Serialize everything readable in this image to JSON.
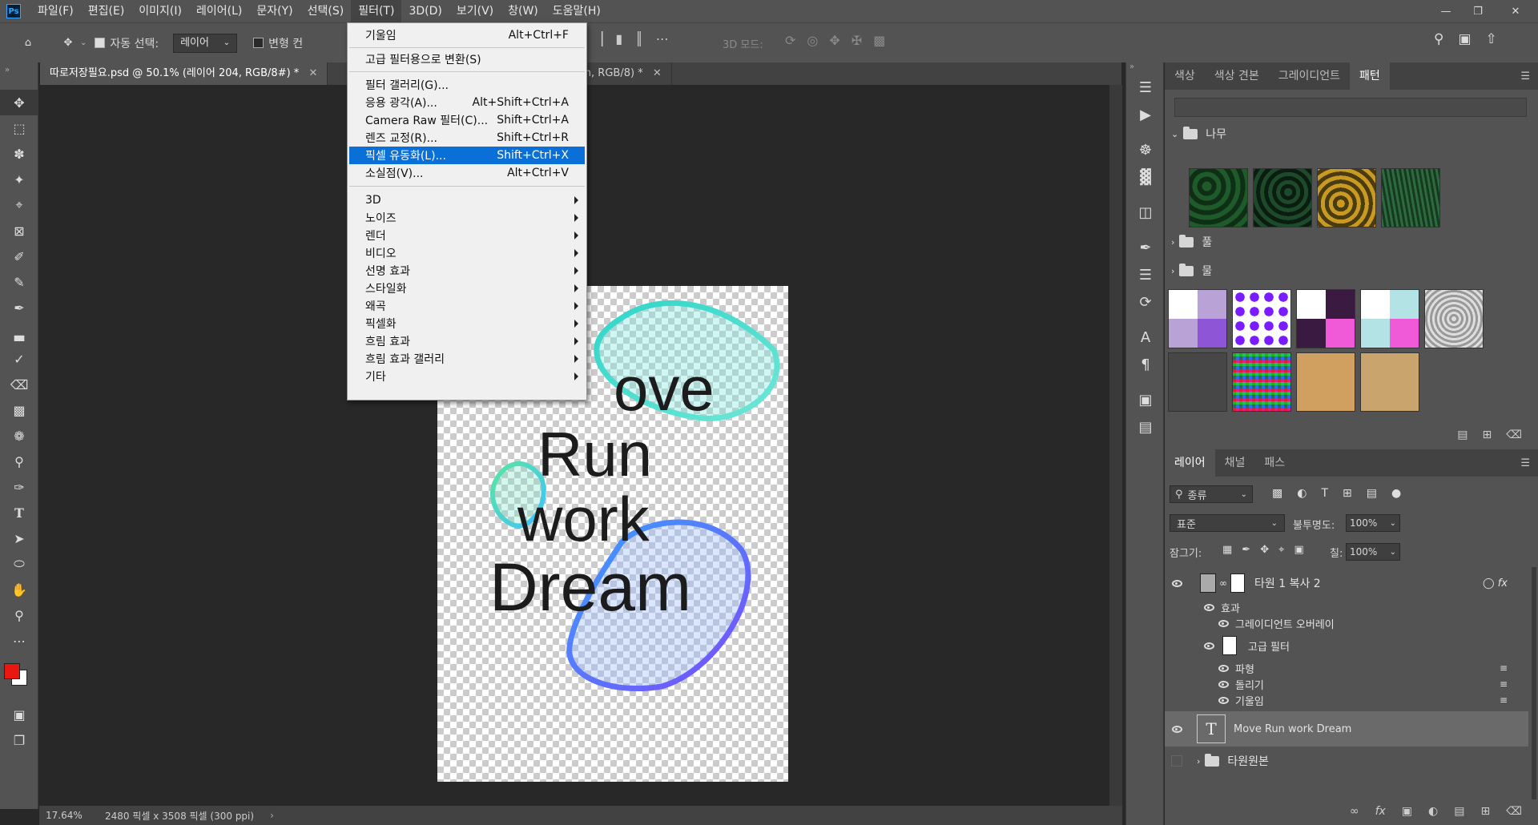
{
  "app": {
    "logo": "Ps"
  },
  "menubar": {
    "items": [
      "파일(F)",
      "편집(E)",
      "이미지(I)",
      "레이어(L)",
      "문자(Y)",
      "선택(S)",
      "필터(T)",
      "3D(D)",
      "보기(V)",
      "창(W)",
      "도움말(H)"
    ],
    "active_index": 6
  },
  "options": {
    "auto_select_label": "자동 선택:",
    "auto_select_value": "레이어",
    "transform_label": "변형 컨",
    "mode_3d_label": "3D 모드:"
  },
  "tabs": [
    {
      "label": "따로저장필요.psd @ 50.1% (레이어 204, RGB/8#) *"
    },
    {
      "label": "m, RGB/8) *"
    }
  ],
  "filter_menu": {
    "items": [
      {
        "label": "기울임",
        "shortcut": "Alt+Ctrl+F"
      },
      {
        "label": "고급 필터용으로 변환(S)",
        "shortcut": ""
      },
      {
        "label": "필터 갤러리(G)...",
        "shortcut": ""
      },
      {
        "label": "응용 광각(A)...",
        "shortcut": "Alt+Shift+Ctrl+A"
      },
      {
        "label": "Camera Raw 필터(C)...",
        "shortcut": "Shift+Ctrl+A"
      },
      {
        "label": "렌즈 교정(R)...",
        "shortcut": "Shift+Ctrl+R"
      },
      {
        "label": "픽셀 유동화(L)...",
        "shortcut": "Shift+Ctrl+X"
      },
      {
        "label": "소실점(V)...",
        "shortcut": "Alt+Ctrl+V"
      },
      {
        "label": "3D"
      },
      {
        "label": "노이즈"
      },
      {
        "label": "렌더"
      },
      {
        "label": "비디오"
      },
      {
        "label": "선명 효과"
      },
      {
        "label": "스타일화"
      },
      {
        "label": "왜곡"
      },
      {
        "label": "픽셀화"
      },
      {
        "label": "흐림 효과"
      },
      {
        "label": "흐림 효과 갤러리"
      },
      {
        "label": "기타"
      }
    ],
    "highlighted": "픽셀 유동화(L)..."
  },
  "canvas": {
    "text_lines": [
      "ove",
      "Run",
      "work",
      "Dream"
    ]
  },
  "status": {
    "zoom": "17.64%",
    "dimensions": "2480 픽셀 x 3508 픽셀 (300 ppi)"
  },
  "pattern_panel": {
    "tabs": [
      "색상",
      "색상 견본",
      "그레이디언트",
      "패턴"
    ],
    "active_tab": "패턴",
    "groups": [
      "나무",
      "풀",
      "물"
    ]
  },
  "layers_panel": {
    "tabs": [
      "레이어",
      "채널",
      "패스"
    ],
    "filter_kind": "종류",
    "blend_mode": "표준",
    "opacity_label": "불투명도:",
    "opacity_value": "100%",
    "lock_label": "잠그기:",
    "fill_label": "칠:",
    "fill_value": "100%",
    "layers": [
      {
        "name": "타원 1 복사 2"
      },
      {
        "name": "효과"
      },
      {
        "name": "그레이디언트 오버레이"
      },
      {
        "name": "고급 필터"
      },
      {
        "name": "파형"
      },
      {
        "name": "돌리기"
      },
      {
        "name": "기울임"
      },
      {
        "name": "Move Run work Dream"
      },
      {
        "name": "타원원본"
      }
    ]
  },
  "colors": {
    "foreground": "#e8170f",
    "background": "#ffffff",
    "highlight": "#0a6fd6"
  }
}
